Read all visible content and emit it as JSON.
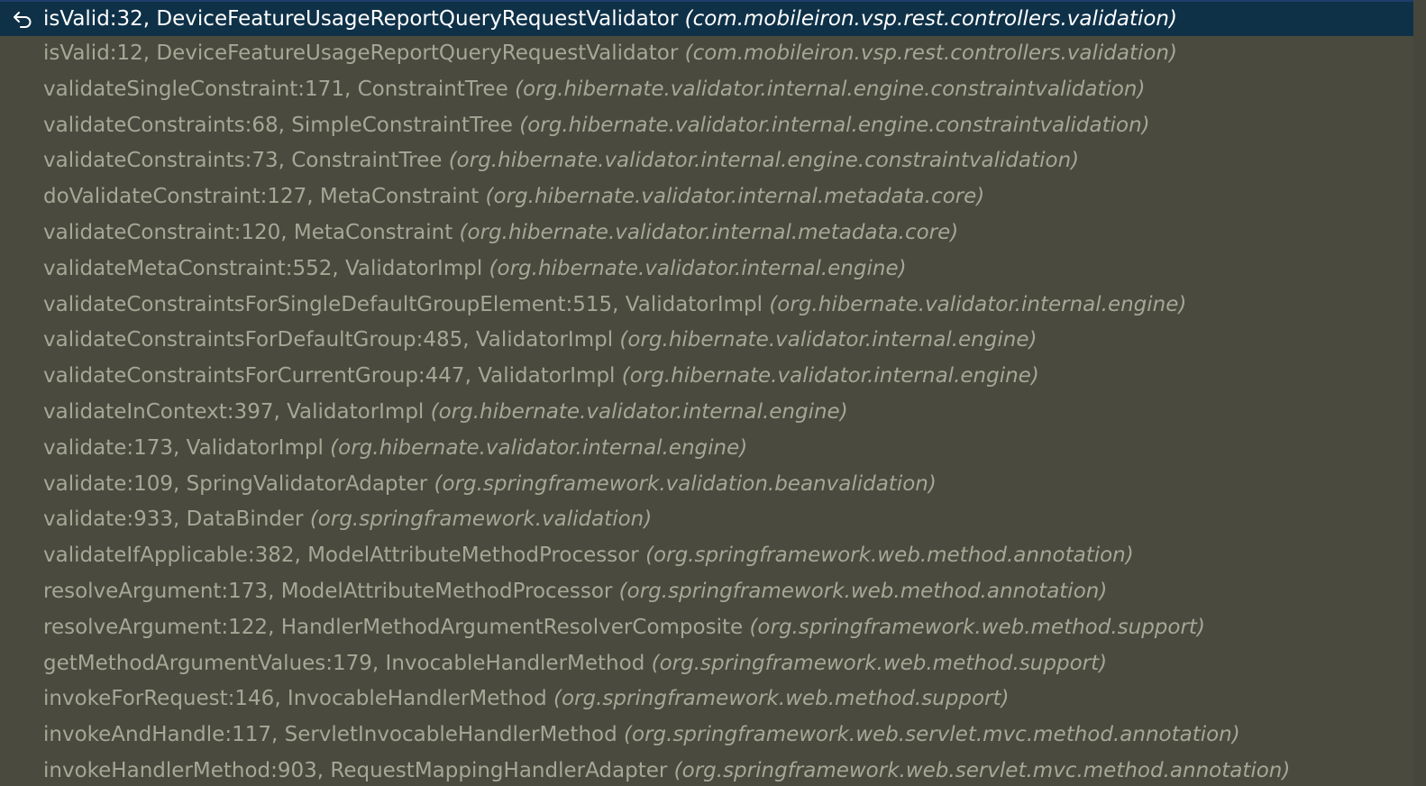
{
  "frames": [
    {
      "method": "isValid:32, DeviceFeatureUsageReportQueryRequestValidator",
      "package": "(com.mobileiron.vsp.rest.controllers.validation)"
    },
    {
      "method": "isValid:12, DeviceFeatureUsageReportQueryRequestValidator",
      "package": "(com.mobileiron.vsp.rest.controllers.validation)"
    },
    {
      "method": "validateSingleConstraint:171, ConstraintTree",
      "package": "(org.hibernate.validator.internal.engine.constraintvalidation)"
    },
    {
      "method": "validateConstraints:68, SimpleConstraintTree",
      "package": "(org.hibernate.validator.internal.engine.constraintvalidation)"
    },
    {
      "method": "validateConstraints:73, ConstraintTree",
      "package": "(org.hibernate.validator.internal.engine.constraintvalidation)"
    },
    {
      "method": "doValidateConstraint:127, MetaConstraint",
      "package": "(org.hibernate.validator.internal.metadata.core)"
    },
    {
      "method": "validateConstraint:120, MetaConstraint",
      "package": "(org.hibernate.validator.internal.metadata.core)"
    },
    {
      "method": "validateMetaConstraint:552, ValidatorImpl",
      "package": "(org.hibernate.validator.internal.engine)"
    },
    {
      "method": "validateConstraintsForSingleDefaultGroupElement:515, ValidatorImpl",
      "package": "(org.hibernate.validator.internal.engine)"
    },
    {
      "method": "validateConstraintsForDefaultGroup:485, ValidatorImpl",
      "package": "(org.hibernate.validator.internal.engine)"
    },
    {
      "method": "validateConstraintsForCurrentGroup:447, ValidatorImpl",
      "package": "(org.hibernate.validator.internal.engine)"
    },
    {
      "method": "validateInContext:397, ValidatorImpl",
      "package": "(org.hibernate.validator.internal.engine)"
    },
    {
      "method": "validate:173, ValidatorImpl",
      "package": "(org.hibernate.validator.internal.engine)"
    },
    {
      "method": "validate:109, SpringValidatorAdapter",
      "package": "(org.springframework.validation.beanvalidation)"
    },
    {
      "method": "validate:933, DataBinder",
      "package": "(org.springframework.validation)"
    },
    {
      "method": "validateIfApplicable:382, ModelAttributeMethodProcessor",
      "package": "(org.springframework.web.method.annotation)"
    },
    {
      "method": "resolveArgument:173, ModelAttributeMethodProcessor",
      "package": "(org.springframework.web.method.annotation)"
    },
    {
      "method": "resolveArgument:122, HandlerMethodArgumentResolverComposite",
      "package": "(org.springframework.web.method.support)"
    },
    {
      "method": "getMethodArgumentValues:179, InvocableHandlerMethod",
      "package": "(org.springframework.web.method.support)"
    },
    {
      "method": "invokeForRequest:146, InvocableHandlerMethod",
      "package": "(org.springframework.web.method.support)"
    },
    {
      "method": "invokeAndHandle:117, ServletInvocableHandlerMethod",
      "package": "(org.springframework.web.servlet.mvc.method.annotation)"
    },
    {
      "method": "invokeHandlerMethod:903, RequestMappingHandlerAdapter",
      "package": "(org.springframework.web.servlet.mvc.method.annotation)"
    }
  ],
  "selected_index": 0,
  "icons": {
    "current_frame": "return-arrow-icon"
  },
  "colors": {
    "background": "#4a4a3f",
    "selected_row": "#0f3148",
    "selected_text": "#ffffff",
    "row_text": "#a7a796"
  }
}
